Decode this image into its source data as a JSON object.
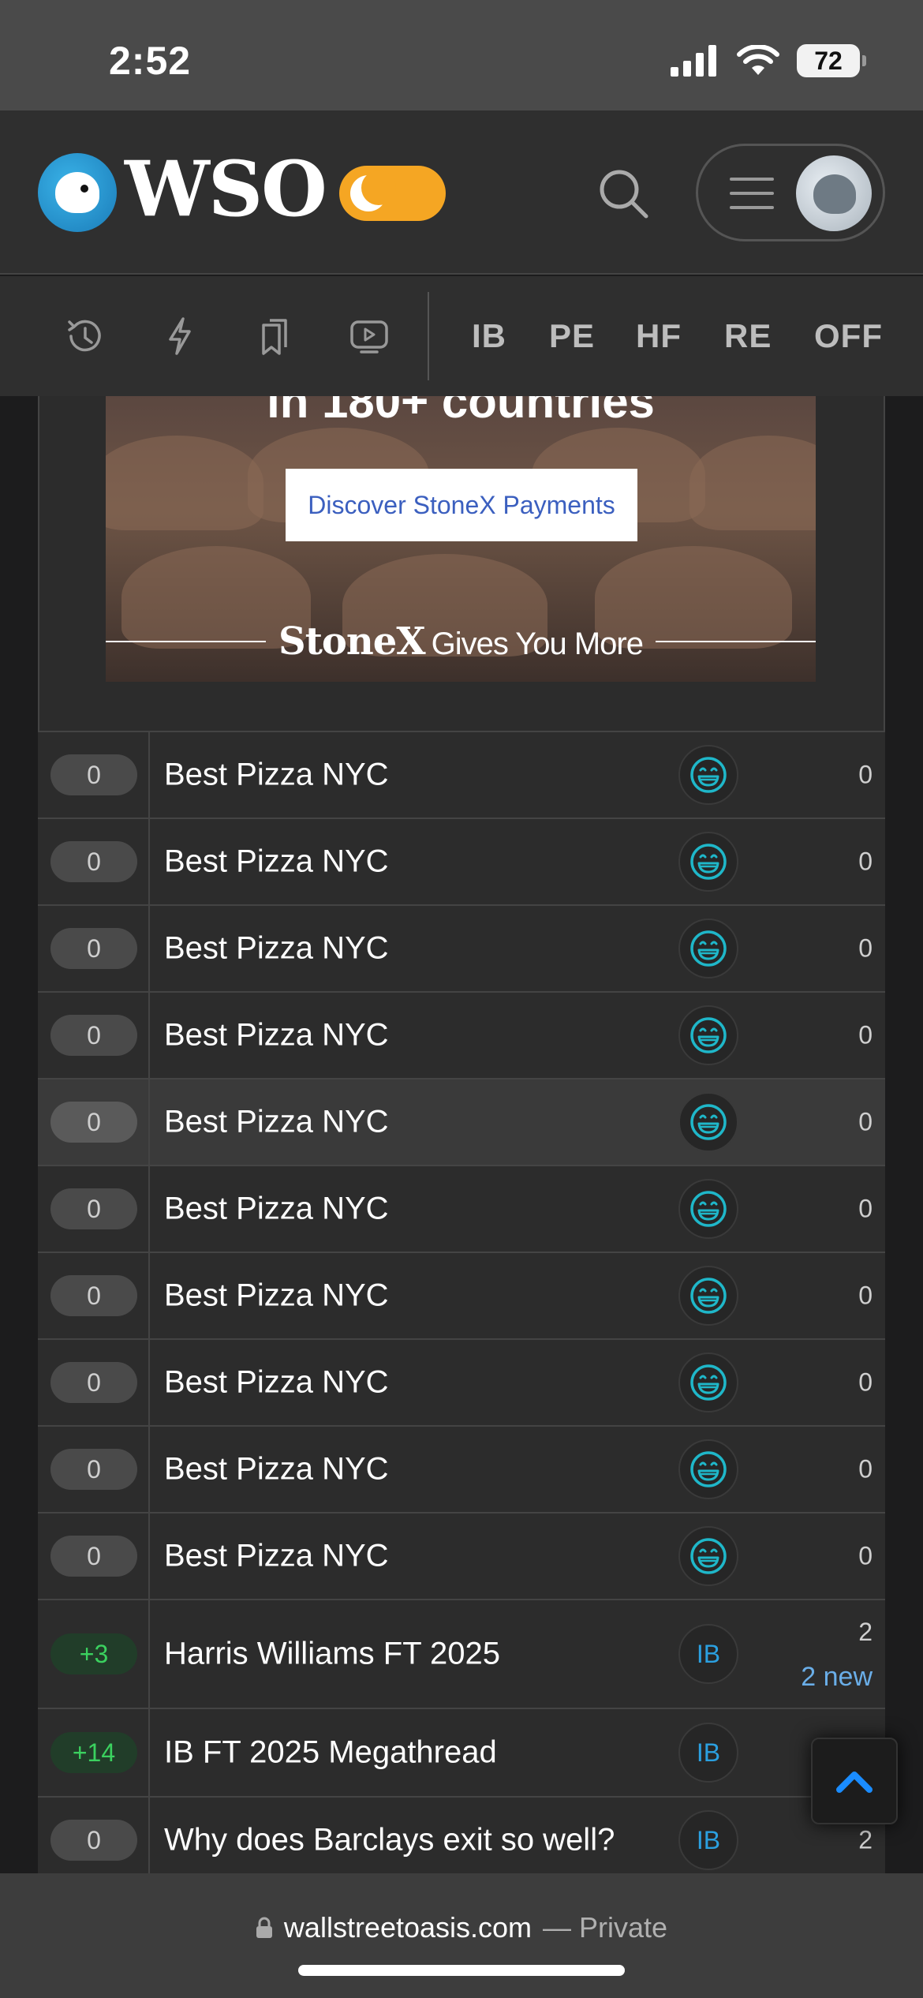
{
  "status_bar": {
    "time": "2:52",
    "battery": "72"
  },
  "header": {
    "logo_text": "WSO"
  },
  "nav": {
    "links": [
      "IB",
      "PE",
      "HF",
      "RE",
      "OFF"
    ]
  },
  "ad": {
    "headline": "in 180+ countries",
    "cta": "Discover StoneX Payments",
    "brand": "StoneX",
    "tagline": "Gives You More"
  },
  "threads": [
    {
      "score": "0",
      "title": "Best Pizza NYC",
      "category_icon": "laughing-face-icon",
      "count": "0"
    },
    {
      "score": "0",
      "title": "Best Pizza NYC",
      "category_icon": "laughing-face-icon",
      "count": "0"
    },
    {
      "score": "0",
      "title": "Best Pizza NYC",
      "category_icon": "laughing-face-icon",
      "count": "0"
    },
    {
      "score": "0",
      "title": "Best Pizza NYC",
      "category_icon": "laughing-face-icon",
      "count": "0"
    },
    {
      "score": "0",
      "title": "Best Pizza NYC",
      "category_icon": "laughing-face-icon",
      "count": "0"
    },
    {
      "score": "0",
      "title": "Best Pizza NYC",
      "category_icon": "laughing-face-icon",
      "count": "0"
    },
    {
      "score": "0",
      "title": "Best Pizza NYC",
      "category_icon": "laughing-face-icon",
      "count": "0"
    },
    {
      "score": "0",
      "title": "Best Pizza NYC",
      "category_icon": "laughing-face-icon",
      "count": "0"
    },
    {
      "score": "0",
      "title": "Best Pizza NYC",
      "category_icon": "laughing-face-icon",
      "count": "0"
    },
    {
      "score": "0",
      "title": "Best Pizza NYC",
      "category_icon": "laughing-face-icon",
      "count": "0"
    },
    {
      "score": "+3",
      "title": "Harris Williams FT 2025",
      "category": "IB",
      "count": "2",
      "new": "2 new"
    },
    {
      "score": "+14",
      "title": "IB FT 2025 Megathread",
      "category": "IB",
      "count": ""
    },
    {
      "score": "0",
      "title": "Why does Barclays exit so well?",
      "category": "IB",
      "count": "2"
    }
  ],
  "browser": {
    "domain": "wallstreetoasis.com",
    "private_label": "— Private"
  },
  "colors": {
    "accent_orange": "#f5a623",
    "link_blue": "#2ba0e0",
    "positive_green": "#3bd15f"
  }
}
